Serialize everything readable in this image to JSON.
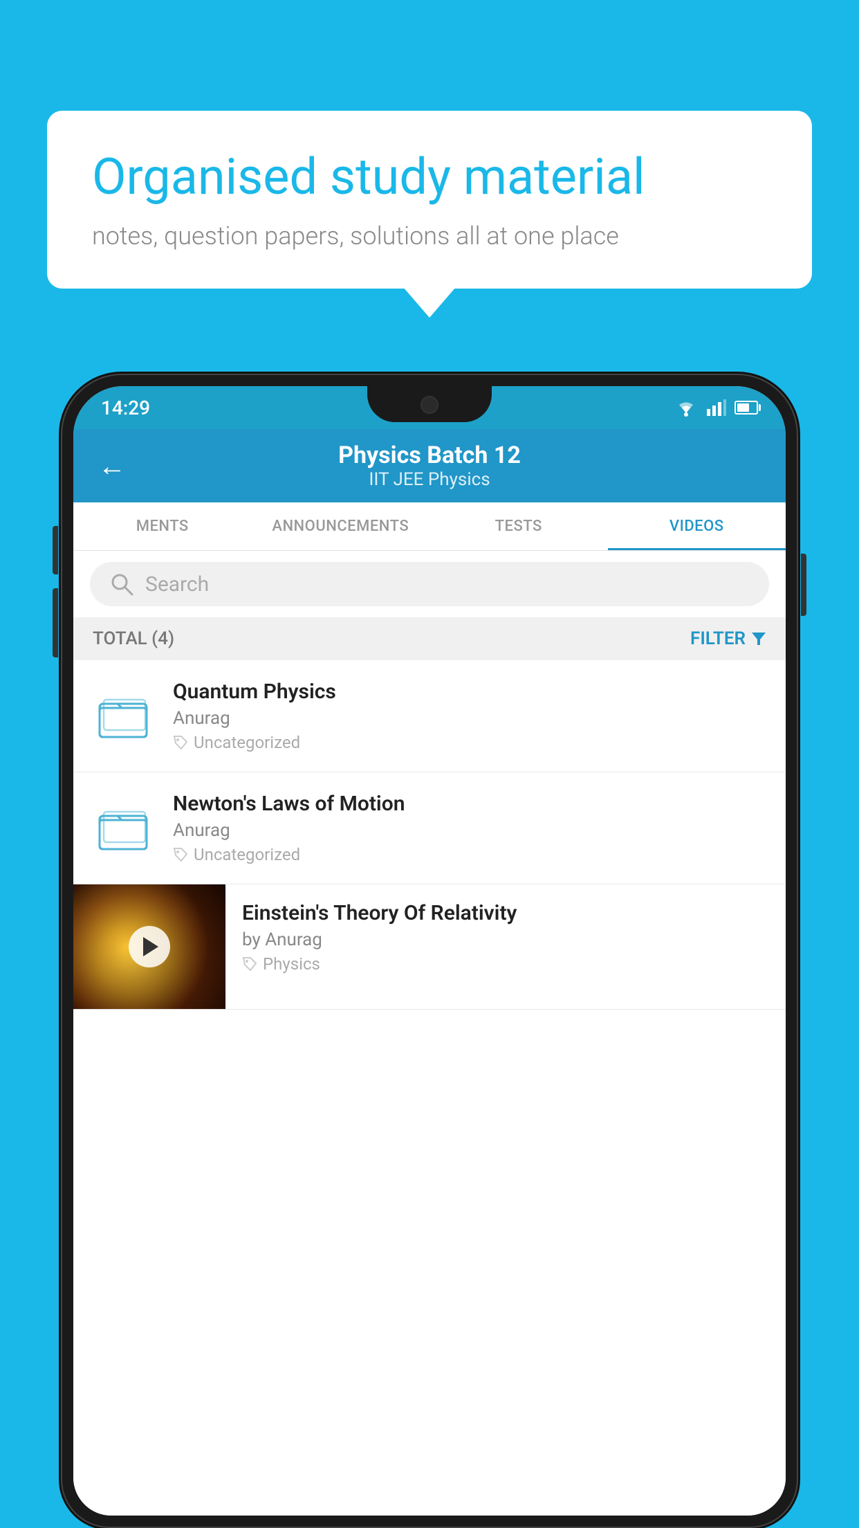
{
  "background_color": "#1ab8e8",
  "bubble": {
    "title": "Organised study material",
    "subtitle": "notes, question papers, solutions all at one place"
  },
  "status_bar": {
    "time": "14:29",
    "wifi": "▾",
    "signal": "◀",
    "battery": ""
  },
  "header": {
    "title": "Physics Batch 12",
    "subtitle": "IIT JEE   Physics",
    "back_label": "←"
  },
  "tabs": [
    {
      "label": "MENTS",
      "active": false
    },
    {
      "label": "ANNOUNCEMENTS",
      "active": false
    },
    {
      "label": "TESTS",
      "active": false
    },
    {
      "label": "VIDEOS",
      "active": true
    }
  ],
  "search": {
    "placeholder": "Search"
  },
  "filter_bar": {
    "total_label": "TOTAL (4)",
    "filter_label": "FILTER"
  },
  "list_items": [
    {
      "type": "folder",
      "title": "Quantum Physics",
      "author": "Anurag",
      "tag": "Uncategorized"
    },
    {
      "type": "folder",
      "title": "Newton's Laws of Motion",
      "author": "Anurag",
      "tag": "Uncategorized"
    },
    {
      "type": "video",
      "title": "Einstein's Theory Of Relativity",
      "author": "by Anurag",
      "tag": "Physics"
    }
  ]
}
